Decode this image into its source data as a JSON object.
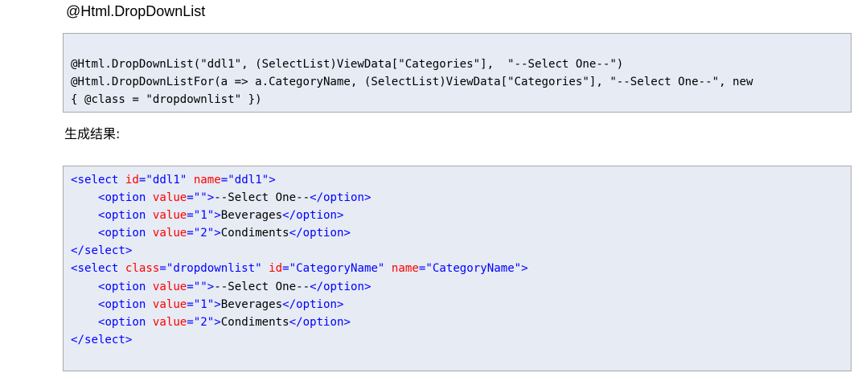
{
  "heading": "@Html.DropDownList",
  "razor_code": [
    "@Html.DropDownList(\"ddl1\", (SelectList)ViewData[\"Categories\"],  \"--Select One--\")",
    "@Html.DropDownListFor(a => a.CategoryName, (SelectList)ViewData[\"Categories\"], \"--Select One--\", new",
    "{ @class = \"dropdownlist\" })"
  ],
  "result_label": "生成结果:",
  "colors": {
    "code_background": "#e6ebf4",
    "code_border": "#a9a9a9",
    "tag": "#0000ff",
    "attribute": "#ff0000",
    "attribute_value": "#0000ff",
    "text": "#000000"
  },
  "html_output": [
    {
      "indent": "",
      "parts": [
        {
          "t": "tag",
          "v": "<select"
        },
        {
          "t": "txt",
          "v": " "
        },
        {
          "t": "attr",
          "v": "id"
        },
        {
          "t": "tag",
          "v": "="
        },
        {
          "t": "val",
          "v": "\"ddl1\""
        },
        {
          "t": "txt",
          "v": " "
        },
        {
          "t": "attr",
          "v": "name"
        },
        {
          "t": "tag",
          "v": "="
        },
        {
          "t": "val",
          "v": "\"ddl1\""
        },
        {
          "t": "tag",
          "v": ">"
        }
      ]
    },
    {
      "indent": "    ",
      "parts": [
        {
          "t": "tag",
          "v": "<option"
        },
        {
          "t": "txt",
          "v": " "
        },
        {
          "t": "attr",
          "v": "value"
        },
        {
          "t": "tag",
          "v": "="
        },
        {
          "t": "val",
          "v": "\"\""
        },
        {
          "t": "tag",
          "v": ">"
        },
        {
          "t": "txt",
          "v": "--Select One--"
        },
        {
          "t": "tag",
          "v": "</option>"
        }
      ]
    },
    {
      "indent": "    ",
      "parts": [
        {
          "t": "tag",
          "v": "<option"
        },
        {
          "t": "txt",
          "v": " "
        },
        {
          "t": "attr",
          "v": "value"
        },
        {
          "t": "tag",
          "v": "="
        },
        {
          "t": "val",
          "v": "\"1\""
        },
        {
          "t": "tag",
          "v": ">"
        },
        {
          "t": "txt",
          "v": "Beverages"
        },
        {
          "t": "tag",
          "v": "</option>"
        }
      ]
    },
    {
      "indent": "    ",
      "parts": [
        {
          "t": "tag",
          "v": "<option"
        },
        {
          "t": "txt",
          "v": " "
        },
        {
          "t": "attr",
          "v": "value"
        },
        {
          "t": "tag",
          "v": "="
        },
        {
          "t": "val",
          "v": "\"2\""
        },
        {
          "t": "tag",
          "v": ">"
        },
        {
          "t": "txt",
          "v": "Condiments"
        },
        {
          "t": "tag",
          "v": "</option>"
        }
      ]
    },
    {
      "indent": "",
      "parts": [
        {
          "t": "tag",
          "v": "</select>"
        }
      ]
    },
    {
      "indent": "",
      "parts": [
        {
          "t": "tag",
          "v": "<select"
        },
        {
          "t": "txt",
          "v": " "
        },
        {
          "t": "attr",
          "v": "class"
        },
        {
          "t": "tag",
          "v": "="
        },
        {
          "t": "val",
          "v": "\"dropdownlist\""
        },
        {
          "t": "txt",
          "v": " "
        },
        {
          "t": "attr",
          "v": "id"
        },
        {
          "t": "tag",
          "v": "="
        },
        {
          "t": "val",
          "v": "\"CategoryName\""
        },
        {
          "t": "txt",
          "v": " "
        },
        {
          "t": "attr",
          "v": "name"
        },
        {
          "t": "tag",
          "v": "="
        },
        {
          "t": "val",
          "v": "\"CategoryName\""
        },
        {
          "t": "tag",
          "v": ">"
        }
      ]
    },
    {
      "indent": "    ",
      "parts": [
        {
          "t": "tag",
          "v": "<option"
        },
        {
          "t": "txt",
          "v": " "
        },
        {
          "t": "attr",
          "v": "value"
        },
        {
          "t": "tag",
          "v": "="
        },
        {
          "t": "val",
          "v": "\"\""
        },
        {
          "t": "tag",
          "v": ">"
        },
        {
          "t": "txt",
          "v": "--Select One--"
        },
        {
          "t": "tag",
          "v": "</option>"
        }
      ]
    },
    {
      "indent": "    ",
      "parts": [
        {
          "t": "tag",
          "v": "<option"
        },
        {
          "t": "txt",
          "v": " "
        },
        {
          "t": "attr",
          "v": "value"
        },
        {
          "t": "tag",
          "v": "="
        },
        {
          "t": "val",
          "v": "\"1\""
        },
        {
          "t": "tag",
          "v": ">"
        },
        {
          "t": "txt",
          "v": "Beverages"
        },
        {
          "t": "tag",
          "v": "</option>"
        }
      ]
    },
    {
      "indent": "    ",
      "parts": [
        {
          "t": "tag",
          "v": "<option"
        },
        {
          "t": "txt",
          "v": " "
        },
        {
          "t": "attr",
          "v": "value"
        },
        {
          "t": "tag",
          "v": "="
        },
        {
          "t": "val",
          "v": "\"2\""
        },
        {
          "t": "tag",
          "v": ">"
        },
        {
          "t": "txt",
          "v": "Condiments"
        },
        {
          "t": "tag",
          "v": "</option>"
        }
      ]
    },
    {
      "indent": "",
      "parts": [
        {
          "t": "tag",
          "v": "</select>"
        }
      ]
    }
  ]
}
